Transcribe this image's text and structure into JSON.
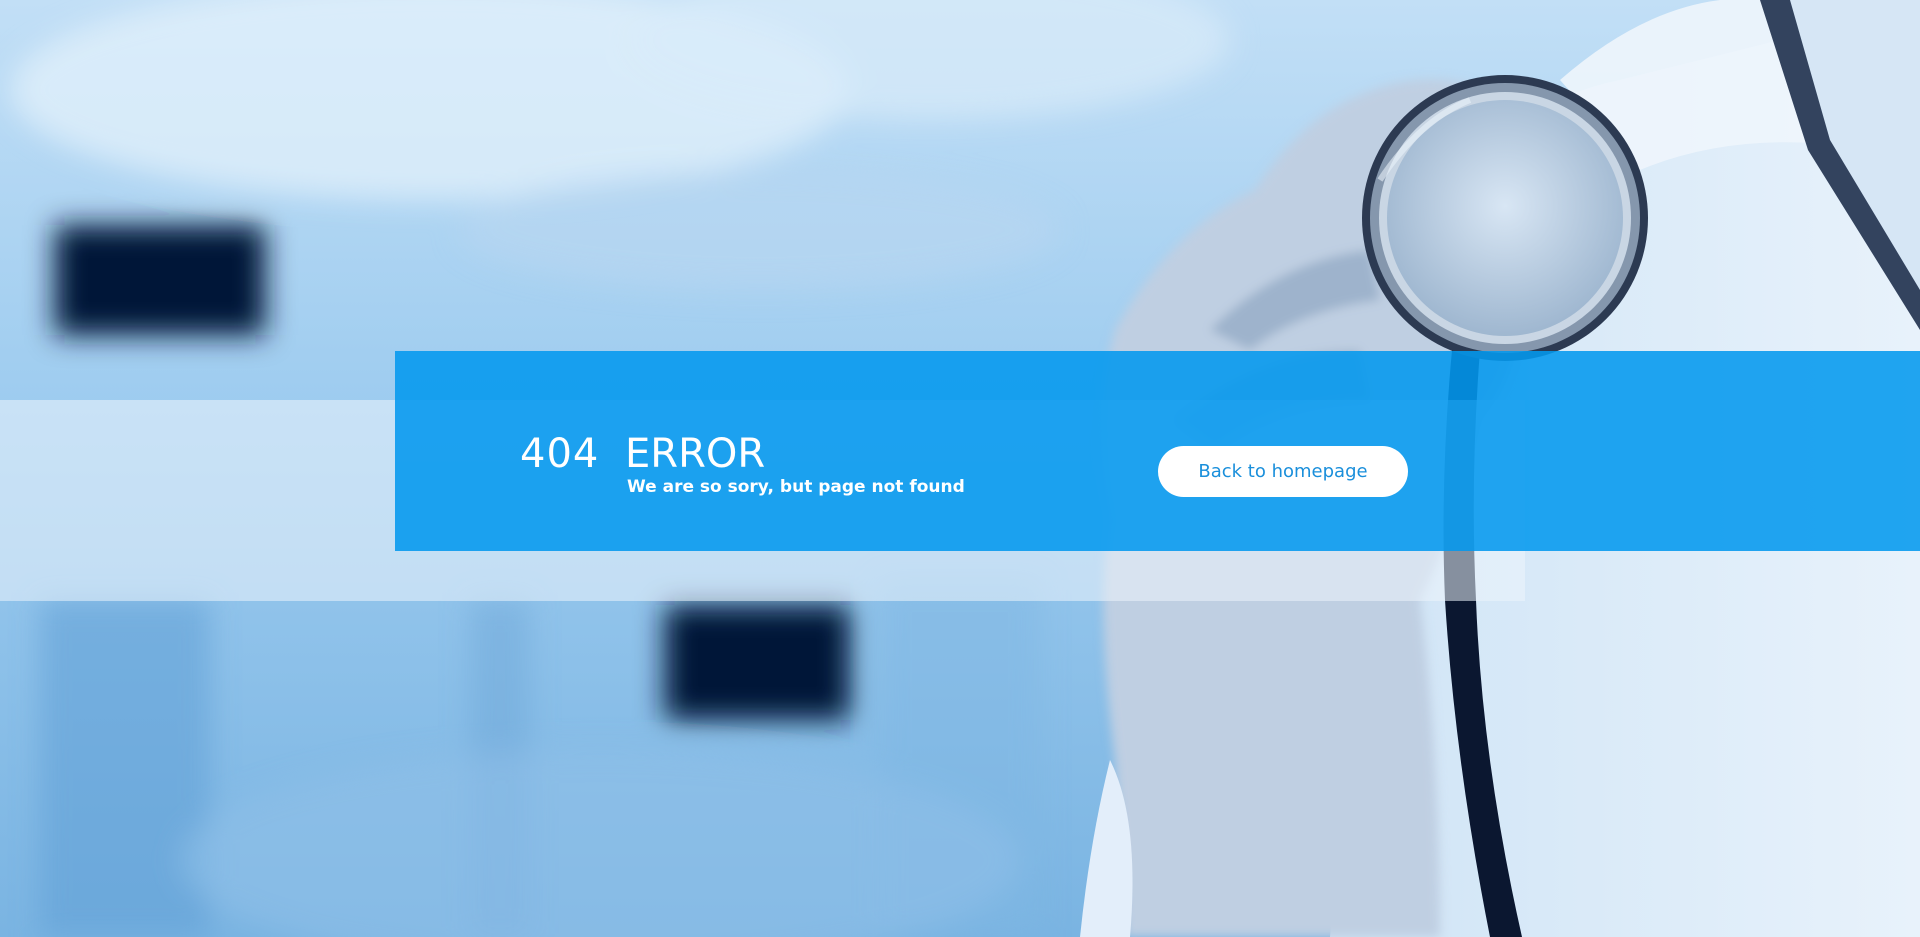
{
  "error": {
    "code": "404",
    "title": "ERROR",
    "message": "We are so sory, but page not found"
  },
  "actions": {
    "back_home_label": "Back to homepage"
  },
  "colors": {
    "accent_blue": "#0399ee",
    "button_text": "#1a8fdb",
    "background_blue": "#8ec4ea"
  }
}
